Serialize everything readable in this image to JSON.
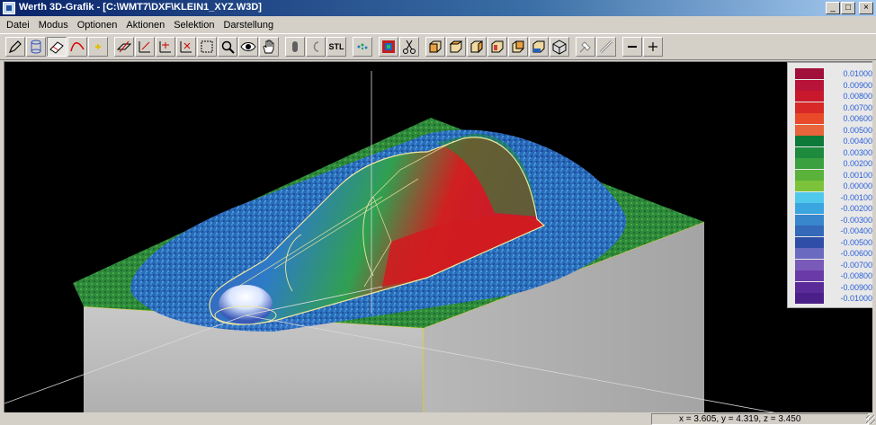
{
  "window": {
    "title": "Werth 3D-Grafik - [C:\\WMT7\\DXF\\KLEIN1_XYZ.W3D]",
    "controls": [
      "_",
      "□",
      "×"
    ]
  },
  "menu": [
    {
      "label": "Datei"
    },
    {
      "label": "Modus"
    },
    {
      "label": "Optionen"
    },
    {
      "label": "Aktionen"
    },
    {
      "label": "Selektion"
    },
    {
      "label": "Darstellung"
    }
  ],
  "toolbar": {
    "stl_label": "STL",
    "icons": [
      "pencil-icon",
      "cylinder-icon",
      "eraser-icon",
      "curve-icon",
      "point-icon",
      "plane-icon",
      "axis-xy-icon",
      "axis-xz-icon",
      "axis-yz-icon",
      "select-box-icon",
      "zoom-icon",
      "eye-icon",
      "hand-icon",
      "cylinder-solid-icon",
      "cylinder-outline-icon",
      "stl-icon",
      "points-icon",
      "palette-icon",
      "scissors-icon",
      "cube-front-icon",
      "cube-top-icon",
      "cube-right-icon",
      "cube-left-icon",
      "cube-back-icon",
      "cube-bottom-icon",
      "cube-iso-icon",
      "probe-icon",
      "probe-alt-icon",
      "minus-icon",
      "plus-icon"
    ]
  },
  "legend": {
    "entries": [
      {
        "value": "0.01000",
        "color": "#a0103a"
      },
      {
        "value": "0.00900",
        "color": "#b8143a"
      },
      {
        "value": "0.00800",
        "color": "#c8182c"
      },
      {
        "value": "0.00700",
        "color": "#d82828"
      },
      {
        "value": "0.00600",
        "color": "#e84a2a"
      },
      {
        "value": "0.00500",
        "color": "#e8643a"
      },
      {
        "value": "0.00400",
        "color": "#0e7a3a"
      },
      {
        "value": "0.00300",
        "color": "#1e8a3e"
      },
      {
        "value": "0.00200",
        "color": "#3aa040"
      },
      {
        "value": "0.00100",
        "color": "#5ab23a"
      },
      {
        "value": "0.00000",
        "color": "#7cc23a"
      },
      {
        "value": "-0.00100",
        "color": "#50c8ec"
      },
      {
        "value": "-0.00200",
        "color": "#3aa6e0"
      },
      {
        "value": "-0.00300",
        "color": "#3886cc"
      },
      {
        "value": "-0.00400",
        "color": "#3468b8"
      },
      {
        "value": "-0.00500",
        "color": "#2e4ea8"
      },
      {
        "value": "-0.00600",
        "color": "#6a6ac0"
      },
      {
        "value": "-0.00700",
        "color": "#7a5ab8"
      },
      {
        "value": "-0.00800",
        "color": "#6a3aa8"
      },
      {
        "value": "-0.00900",
        "color": "#5a2a98"
      },
      {
        "value": "-0.01000",
        "color": "#4a2088"
      }
    ]
  },
  "status": {
    "coords": "x = 3.605, y = 4.319, z = 3.450"
  }
}
